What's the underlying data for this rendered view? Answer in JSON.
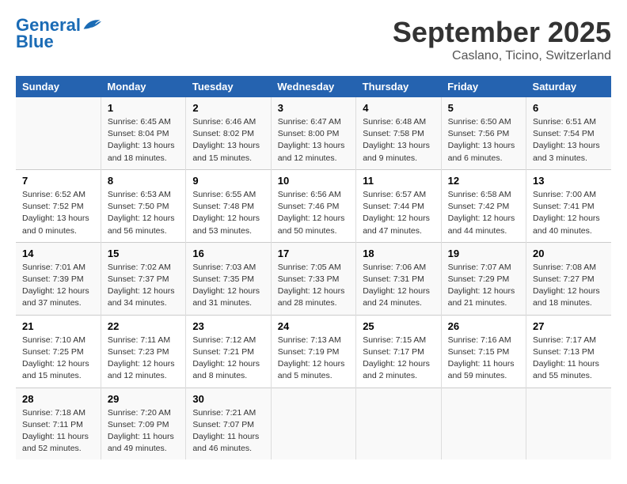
{
  "header": {
    "logo_line1": "General",
    "logo_line2": "Blue",
    "month": "September 2025",
    "location": "Caslano, Ticino, Switzerland"
  },
  "weekdays": [
    "Sunday",
    "Monday",
    "Tuesday",
    "Wednesday",
    "Thursday",
    "Friday",
    "Saturday"
  ],
  "weeks": [
    [
      {
        "num": "",
        "info": ""
      },
      {
        "num": "1",
        "info": "Sunrise: 6:45 AM\nSunset: 8:04 PM\nDaylight: 13 hours\nand 18 minutes."
      },
      {
        "num": "2",
        "info": "Sunrise: 6:46 AM\nSunset: 8:02 PM\nDaylight: 13 hours\nand 15 minutes."
      },
      {
        "num": "3",
        "info": "Sunrise: 6:47 AM\nSunset: 8:00 PM\nDaylight: 13 hours\nand 12 minutes."
      },
      {
        "num": "4",
        "info": "Sunrise: 6:48 AM\nSunset: 7:58 PM\nDaylight: 13 hours\nand 9 minutes."
      },
      {
        "num": "5",
        "info": "Sunrise: 6:50 AM\nSunset: 7:56 PM\nDaylight: 13 hours\nand 6 minutes."
      },
      {
        "num": "6",
        "info": "Sunrise: 6:51 AM\nSunset: 7:54 PM\nDaylight: 13 hours\nand 3 minutes."
      }
    ],
    [
      {
        "num": "7",
        "info": "Sunrise: 6:52 AM\nSunset: 7:52 PM\nDaylight: 13 hours\nand 0 minutes."
      },
      {
        "num": "8",
        "info": "Sunrise: 6:53 AM\nSunset: 7:50 PM\nDaylight: 12 hours\nand 56 minutes."
      },
      {
        "num": "9",
        "info": "Sunrise: 6:55 AM\nSunset: 7:48 PM\nDaylight: 12 hours\nand 53 minutes."
      },
      {
        "num": "10",
        "info": "Sunrise: 6:56 AM\nSunset: 7:46 PM\nDaylight: 12 hours\nand 50 minutes."
      },
      {
        "num": "11",
        "info": "Sunrise: 6:57 AM\nSunset: 7:44 PM\nDaylight: 12 hours\nand 47 minutes."
      },
      {
        "num": "12",
        "info": "Sunrise: 6:58 AM\nSunset: 7:42 PM\nDaylight: 12 hours\nand 44 minutes."
      },
      {
        "num": "13",
        "info": "Sunrise: 7:00 AM\nSunset: 7:41 PM\nDaylight: 12 hours\nand 40 minutes."
      }
    ],
    [
      {
        "num": "14",
        "info": "Sunrise: 7:01 AM\nSunset: 7:39 PM\nDaylight: 12 hours\nand 37 minutes."
      },
      {
        "num": "15",
        "info": "Sunrise: 7:02 AM\nSunset: 7:37 PM\nDaylight: 12 hours\nand 34 minutes."
      },
      {
        "num": "16",
        "info": "Sunrise: 7:03 AM\nSunset: 7:35 PM\nDaylight: 12 hours\nand 31 minutes."
      },
      {
        "num": "17",
        "info": "Sunrise: 7:05 AM\nSunset: 7:33 PM\nDaylight: 12 hours\nand 28 minutes."
      },
      {
        "num": "18",
        "info": "Sunrise: 7:06 AM\nSunset: 7:31 PM\nDaylight: 12 hours\nand 24 minutes."
      },
      {
        "num": "19",
        "info": "Sunrise: 7:07 AM\nSunset: 7:29 PM\nDaylight: 12 hours\nand 21 minutes."
      },
      {
        "num": "20",
        "info": "Sunrise: 7:08 AM\nSunset: 7:27 PM\nDaylight: 12 hours\nand 18 minutes."
      }
    ],
    [
      {
        "num": "21",
        "info": "Sunrise: 7:10 AM\nSunset: 7:25 PM\nDaylight: 12 hours\nand 15 minutes."
      },
      {
        "num": "22",
        "info": "Sunrise: 7:11 AM\nSunset: 7:23 PM\nDaylight: 12 hours\nand 12 minutes."
      },
      {
        "num": "23",
        "info": "Sunrise: 7:12 AM\nSunset: 7:21 PM\nDaylight: 12 hours\nand 8 minutes."
      },
      {
        "num": "24",
        "info": "Sunrise: 7:13 AM\nSunset: 7:19 PM\nDaylight: 12 hours\nand 5 minutes."
      },
      {
        "num": "25",
        "info": "Sunrise: 7:15 AM\nSunset: 7:17 PM\nDaylight: 12 hours\nand 2 minutes."
      },
      {
        "num": "26",
        "info": "Sunrise: 7:16 AM\nSunset: 7:15 PM\nDaylight: 11 hours\nand 59 minutes."
      },
      {
        "num": "27",
        "info": "Sunrise: 7:17 AM\nSunset: 7:13 PM\nDaylight: 11 hours\nand 55 minutes."
      }
    ],
    [
      {
        "num": "28",
        "info": "Sunrise: 7:18 AM\nSunset: 7:11 PM\nDaylight: 11 hours\nand 52 minutes."
      },
      {
        "num": "29",
        "info": "Sunrise: 7:20 AM\nSunset: 7:09 PM\nDaylight: 11 hours\nand 49 minutes."
      },
      {
        "num": "30",
        "info": "Sunrise: 7:21 AM\nSunset: 7:07 PM\nDaylight: 11 hours\nand 46 minutes."
      },
      {
        "num": "",
        "info": ""
      },
      {
        "num": "",
        "info": ""
      },
      {
        "num": "",
        "info": ""
      },
      {
        "num": "",
        "info": ""
      }
    ]
  ]
}
